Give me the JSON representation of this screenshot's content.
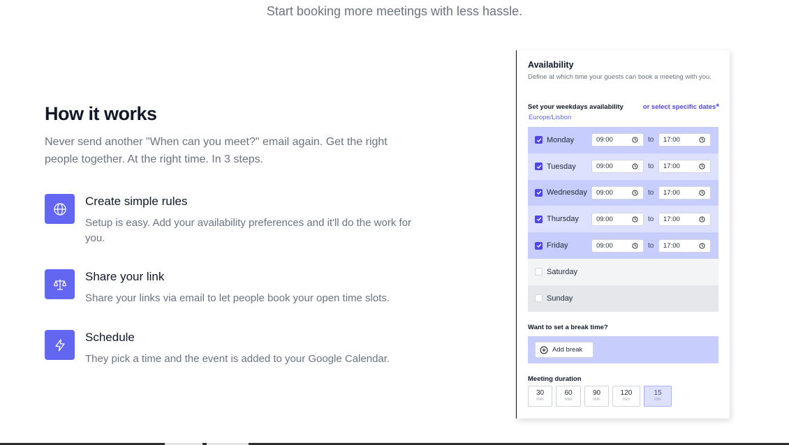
{
  "hero": {
    "subtitle": "Start booking more meetings with less hassle."
  },
  "how": {
    "title": "How it works",
    "lead": "Never send another \"When can you meet?\" email again. Get the right people together. At the right time. In 3 steps.",
    "steps": [
      {
        "icon": "globe-icon",
        "title": "Create simple rules",
        "desc": "Setup is easy. Add your availability preferences and it'll do the work for you."
      },
      {
        "icon": "scale-icon",
        "title": "Share your link",
        "desc": "Share your links via email to let people book your open time slots."
      },
      {
        "icon": "lightning-icon",
        "title": "Schedule",
        "desc": "They pick a time and the event is added to your Google Calendar."
      }
    ]
  },
  "availability": {
    "title": "Availability",
    "desc": "Define at which time your guests can book a meeting with you.",
    "weekdays_label": "Set your weekdays availability",
    "specific_dates_link": "or select specific dates",
    "specific_dates_star": "*",
    "timezone": "Europe/Lisbon",
    "to_label": "to",
    "days": [
      {
        "name": "Monday",
        "checked": true,
        "from": "09:00",
        "to": "17:00"
      },
      {
        "name": "Tuesday",
        "checked": true,
        "from": "09:00",
        "to": "17:00"
      },
      {
        "name": "Wednesday",
        "checked": true,
        "from": "09:00",
        "to": "17:00"
      },
      {
        "name": "Thursday",
        "checked": true,
        "from": "09:00",
        "to": "17:00"
      },
      {
        "name": "Friday",
        "checked": true,
        "from": "09:00",
        "to": "17:00"
      },
      {
        "name": "Saturday",
        "checked": false
      },
      {
        "name": "Sunday",
        "checked": false
      }
    ],
    "break_label": "Want to set a break time?",
    "add_break": "Add break",
    "duration_label": "Meeting duration",
    "durations": [
      {
        "value": "30",
        "unit": "min",
        "selected": false
      },
      {
        "value": "60",
        "unit": "min",
        "selected": false
      },
      {
        "value": "90",
        "unit": "min",
        "selected": false
      },
      {
        "value": "120",
        "unit": "min",
        "selected": false
      },
      {
        "value": "15",
        "unit": "min",
        "selected": true
      }
    ]
  },
  "colors": {
    "accent": "#6366f1",
    "accent_dark": "#4f46e5",
    "row_on": "#c7cdfc",
    "row_on_alt": "#dde1fd"
  }
}
